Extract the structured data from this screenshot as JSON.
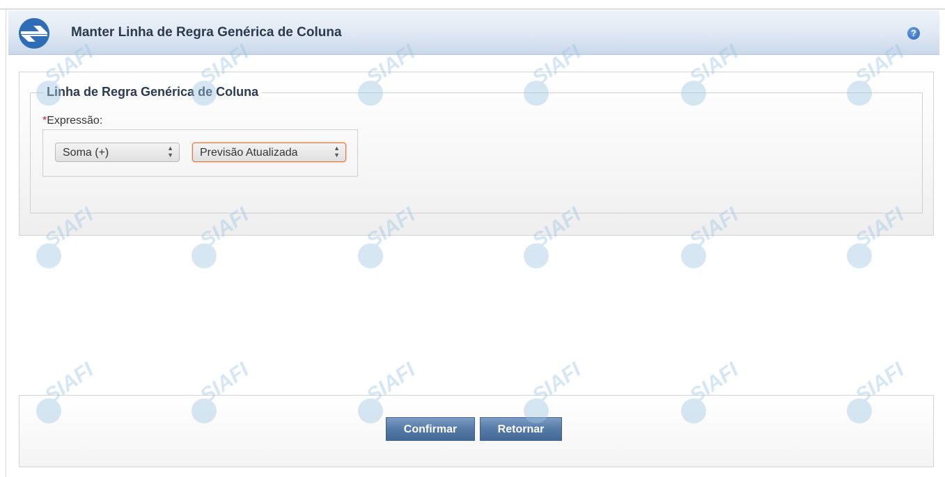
{
  "header": {
    "title": "Manter Linha de Regra Genérica de Coluna",
    "help_label": "?"
  },
  "form": {
    "legend": "Linha de Regra Genérica de Coluna",
    "required_marker": "*",
    "expression_label": "Expressão:",
    "operator_select": {
      "value": "Soma (+)"
    },
    "column_select": {
      "value": "Previsão Atualizada"
    }
  },
  "buttons": {
    "confirm_label": "Confirmar",
    "return_label": "Retornar"
  },
  "watermark": {
    "text": "SIAFI"
  },
  "colors": {
    "accent": "#557aa6",
    "header_title": "#2b3a4e",
    "focus_border": "#e0733a",
    "required": "#cc2222",
    "watermark": "#9ec7e3"
  }
}
